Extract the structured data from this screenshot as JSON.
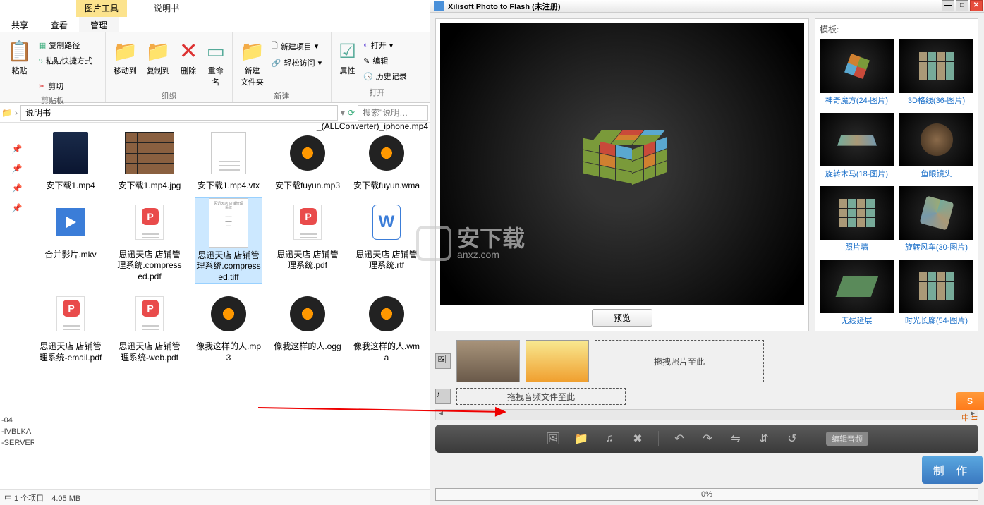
{
  "explorer": {
    "title_tab": "图片工具",
    "sub_tab": "说明书",
    "tabs": [
      "共享",
      "查看",
      "管理"
    ],
    "clipboard": {
      "copy_path": "复制路径",
      "paste_shortcut": "粘贴快捷方式",
      "paste": "粘贴",
      "cut": "剪切",
      "label": "剪贴板"
    },
    "organize": {
      "move_to": "移动到",
      "copy_to": "复制到",
      "delete": "删除",
      "rename": "重命名",
      "label": "组织"
    },
    "new_group": {
      "new_folder": "新建\n文件夹",
      "new_item": "新建项目",
      "easy_access": "轻松访问",
      "label": "新建"
    },
    "open_group": {
      "properties": "属性",
      "open": "打开",
      "edit": "编辑",
      "history": "历史记录",
      "label": "打开"
    },
    "path": "说明书",
    "search_placeholder": "搜索\"说明…",
    "top_right": "_(ALLConverter)_iphone.mp4",
    "sidebar_items": [
      "-04",
      "-IVBLKA",
      "-SERVER"
    ],
    "files": [
      {
        "name": "安下载1.mp4",
        "type": "video"
      },
      {
        "name": "安下载1.mp4.jpg",
        "type": "thumbstrip"
      },
      {
        "name": "安下载1.mp4.vtx",
        "type": "doc"
      },
      {
        "name": "安下载fuyun.mp3",
        "type": "audio"
      },
      {
        "name": "安下载fuyun.wma",
        "type": "audio"
      },
      {
        "name": "合并影片.mkv",
        "type": "mov"
      },
      {
        "name": "思迅天店 店铺管理系统.compressed.pdf",
        "type": "pdf"
      },
      {
        "name": "思迅天店 店铺管理系统.compressed.tiff",
        "type": "page",
        "selected": true
      },
      {
        "name": "思迅天店 店铺管理系统.pdf",
        "type": "pdf"
      },
      {
        "name": "思迅天店 店铺管理系统.rtf",
        "type": "wdoc"
      },
      {
        "name": "思迅天店 店铺管理系统-email.pdf",
        "type": "pdf"
      },
      {
        "name": "思迅天店 店铺管理系统-web.pdf",
        "type": "pdf"
      },
      {
        "name": "像我这样的人.mp3",
        "type": "audio"
      },
      {
        "name": "像我这样的人.ogg",
        "type": "audio"
      },
      {
        "name": "像我这样的人.wma",
        "type": "audio"
      }
    ],
    "status": "中 1 个项目　4.05 MB"
  },
  "xili": {
    "title": "Xilisoft Photo to Flash (未注册)",
    "preview_btn": "预览",
    "template_label": "模板:",
    "templates": [
      {
        "name": "神奇魔方(24-图片)"
      },
      {
        "name": "3D格线(36-图片)"
      },
      {
        "name": "旋转木马(18-图片)"
      },
      {
        "name": "鱼眼镜头"
      },
      {
        "name": "照片墙"
      },
      {
        "name": "旋转风车(30-图片)"
      },
      {
        "name": "无线延展"
      },
      {
        "name": "时光长廊(54-图片)"
      }
    ],
    "drop_photo": "拖拽照片至此",
    "drop_audio": "拖拽音频文件至此",
    "edit_audio": "编辑音频",
    "make": "制 作",
    "progress": "0%"
  },
  "watermark": {
    "main": "安下载",
    "sub": "anxz.com"
  },
  "ime": "中"
}
